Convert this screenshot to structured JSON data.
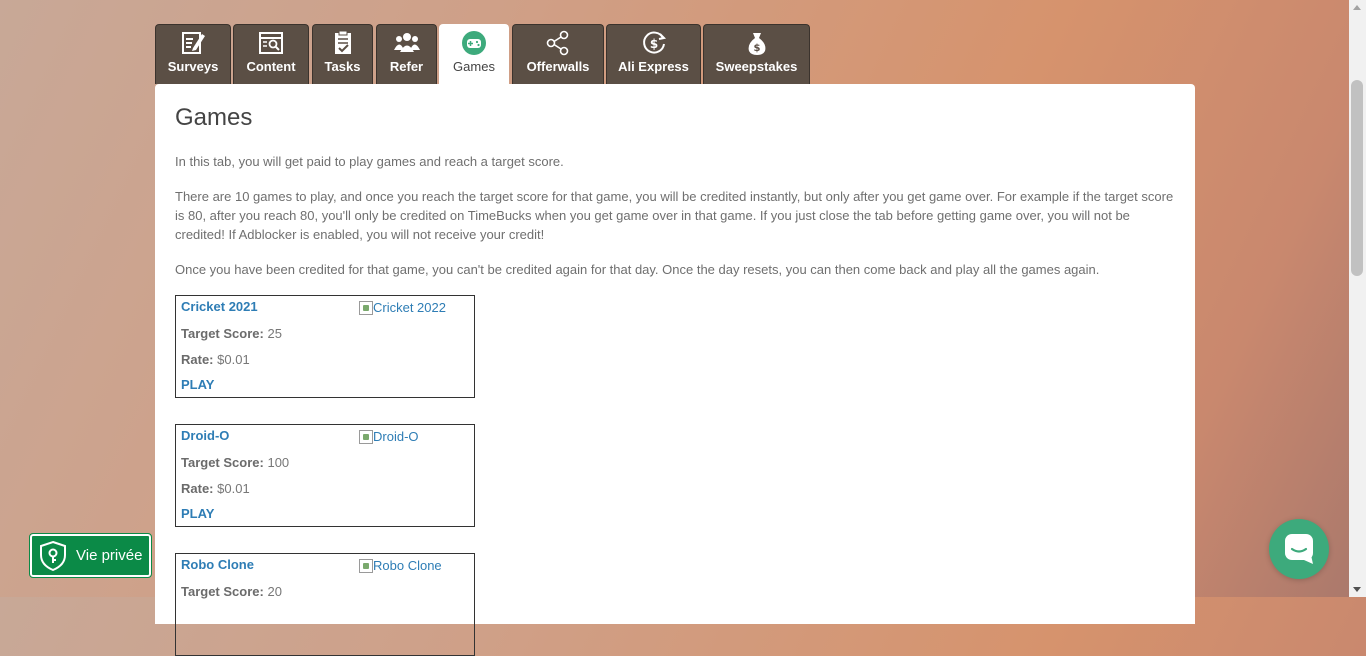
{
  "tabs": [
    {
      "label": "Surveys",
      "icon": "survey-icon"
    },
    {
      "label": "Content",
      "icon": "content-icon"
    },
    {
      "label": "Tasks",
      "icon": "tasks-icon"
    },
    {
      "label": "Refer",
      "icon": "refer-icon"
    },
    {
      "label": "Games",
      "icon": "gamepad-icon",
      "active": true
    },
    {
      "label": "Offerwalls",
      "icon": "share-icon"
    },
    {
      "label": "Ali Express",
      "icon": "dollar-circle-icon"
    },
    {
      "label": "Sweepstakes",
      "icon": "money-bag-icon"
    }
  ],
  "page": {
    "title": "Games",
    "intro": "In this tab, you will get paid to play games and reach a target score.",
    "rules": "There are 10 games to play, and once you reach the target score for that game, you will be credited instantly, but only after you get game over. For example if the target score is 80, after you reach 80, you'll only be credited on TimeBucks when you get game over in that game. If you just close the tab before getting game over, you will not be credited! If Adblocker is enabled, you will not receive your credit!",
    "reset": "Once you have been credited for that game, you can't be credited again for that day. Once the day resets, you can then come back and play all the games again."
  },
  "labels": {
    "target": "Target Score:",
    "rate": "Rate:",
    "play": "PLAY"
  },
  "games": [
    {
      "name": "Cricket 2021",
      "image_alt": "Cricket 2022",
      "target": "25",
      "rate": "$0.01"
    },
    {
      "name": "Droid-O",
      "image_alt": "Droid-O",
      "target": "100",
      "rate": "$0.01"
    },
    {
      "name": "Robo Clone",
      "image_alt": "Robo Clone",
      "target": "20",
      "rate": ""
    }
  ],
  "privacy": {
    "label": "Vie privée"
  },
  "colors": {
    "tab_bg": "#5b4f45",
    "link": "#2e7db5",
    "privacy_bg": "#0b8a47",
    "chat_bg": "#3daa7c",
    "games_icon": "#3daa7c"
  }
}
